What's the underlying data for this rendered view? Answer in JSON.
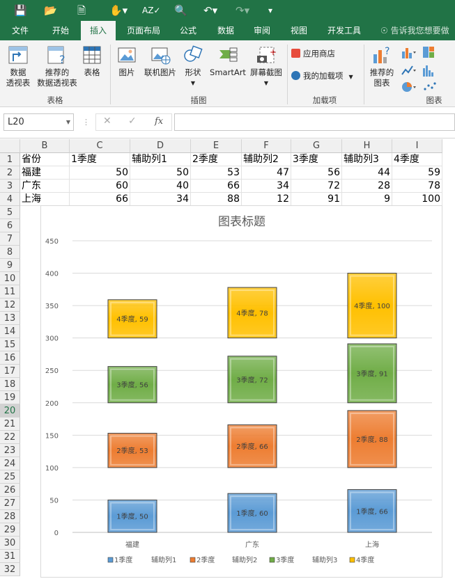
{
  "toolbar_icons": [
    "save-icon",
    "open-icon",
    "new-file-icon",
    "touch-mode-icon",
    "spelling-icon",
    "print-preview-icon",
    "undo-icon",
    "redo-icon",
    "customize-qat-icon"
  ],
  "tabs": [
    "文件",
    "开始",
    "插入",
    "页面布局",
    "公式",
    "数据",
    "审阅",
    "视图",
    "开发工具"
  ],
  "active_tab": "插入",
  "tell_me": "告诉我您想要做什",
  "ribbon": {
    "pivot_l1": "数据",
    "pivot_l2": "透视表",
    "rec_pivot_l1": "推荐的",
    "rec_pivot_l2": "数据透视表",
    "table": "表格",
    "group_tables": "表格",
    "picture": "图片",
    "online_picture": "联机图片",
    "shapes": "形状",
    "smartart": "SmartArt",
    "screenshot": "屏幕截图",
    "group_illus": "插图",
    "store": "应用商店",
    "my_addins": "我的加载项",
    "group_addins": "加载项",
    "rec_chart_l1": "推荐的",
    "rec_chart_l2": "图表",
    "group_charts": "图表"
  },
  "formula_bar": {
    "name_box": "L20",
    "fx": "fx",
    "formula": ""
  },
  "columns": [
    "B",
    "C",
    "D",
    "E",
    "F",
    "G",
    "H",
    "I"
  ],
  "rows": [
    "1",
    "2",
    "3",
    "4",
    "5",
    "6",
    "7",
    "8",
    "9",
    "10",
    "11",
    "12",
    "13",
    "14",
    "15",
    "16",
    "17",
    "18",
    "19",
    "20",
    "21",
    "22",
    "23",
    "24",
    "25",
    "26",
    "27",
    "28",
    "29",
    "30",
    "31",
    "32"
  ],
  "selected_row": "20",
  "sheet": {
    "header": [
      "省份",
      "1季度",
      "辅助列1",
      "2季度",
      "辅助列2",
      "3季度",
      "辅助列3",
      "4季度"
    ],
    "data": [
      [
        "福建",
        "50",
        "50",
        "53",
        "47",
        "56",
        "44",
        "59"
      ],
      [
        "广东",
        "60",
        "40",
        "66",
        "34",
        "72",
        "28",
        "78"
      ],
      [
        "上海",
        "66",
        "34",
        "88",
        "12",
        "91",
        "9",
        "100"
      ]
    ]
  },
  "colors": {
    "q1": "#5b9bd5",
    "q2": "#ed7d31",
    "q3": "#70ad47",
    "q4": "#ffc000",
    "excel_green": "#217346"
  },
  "chart_data": {
    "type": "bar",
    "stacked": true,
    "title": "图表标题",
    "categories": [
      "福建",
      "广东",
      "上海"
    ],
    "ylim": [
      0,
      450
    ],
    "yticks": [
      0,
      50,
      100,
      150,
      200,
      250,
      300,
      350,
      400,
      450
    ],
    "grid": true,
    "legend_position": "bottom",
    "series": [
      {
        "name": "1季度",
        "values": [
          50,
          60,
          66
        ],
        "visible": true,
        "color": "#5b9bd5"
      },
      {
        "name": "辅助列1",
        "values": [
          50,
          40,
          34
        ],
        "visible": false
      },
      {
        "name": "2季度",
        "values": [
          53,
          66,
          88
        ],
        "visible": true,
        "color": "#ed7d31"
      },
      {
        "name": "辅助列2",
        "values": [
          47,
          34,
          12
        ],
        "visible": false
      },
      {
        "name": "3季度",
        "values": [
          56,
          72,
          91
        ],
        "visible": true,
        "color": "#70ad47"
      },
      {
        "name": "辅助列3",
        "values": [
          44,
          28,
          9
        ],
        "visible": false
      },
      {
        "name": "4季度",
        "values": [
          59,
          78,
          100
        ],
        "visible": true,
        "color": "#ffc000"
      }
    ]
  }
}
